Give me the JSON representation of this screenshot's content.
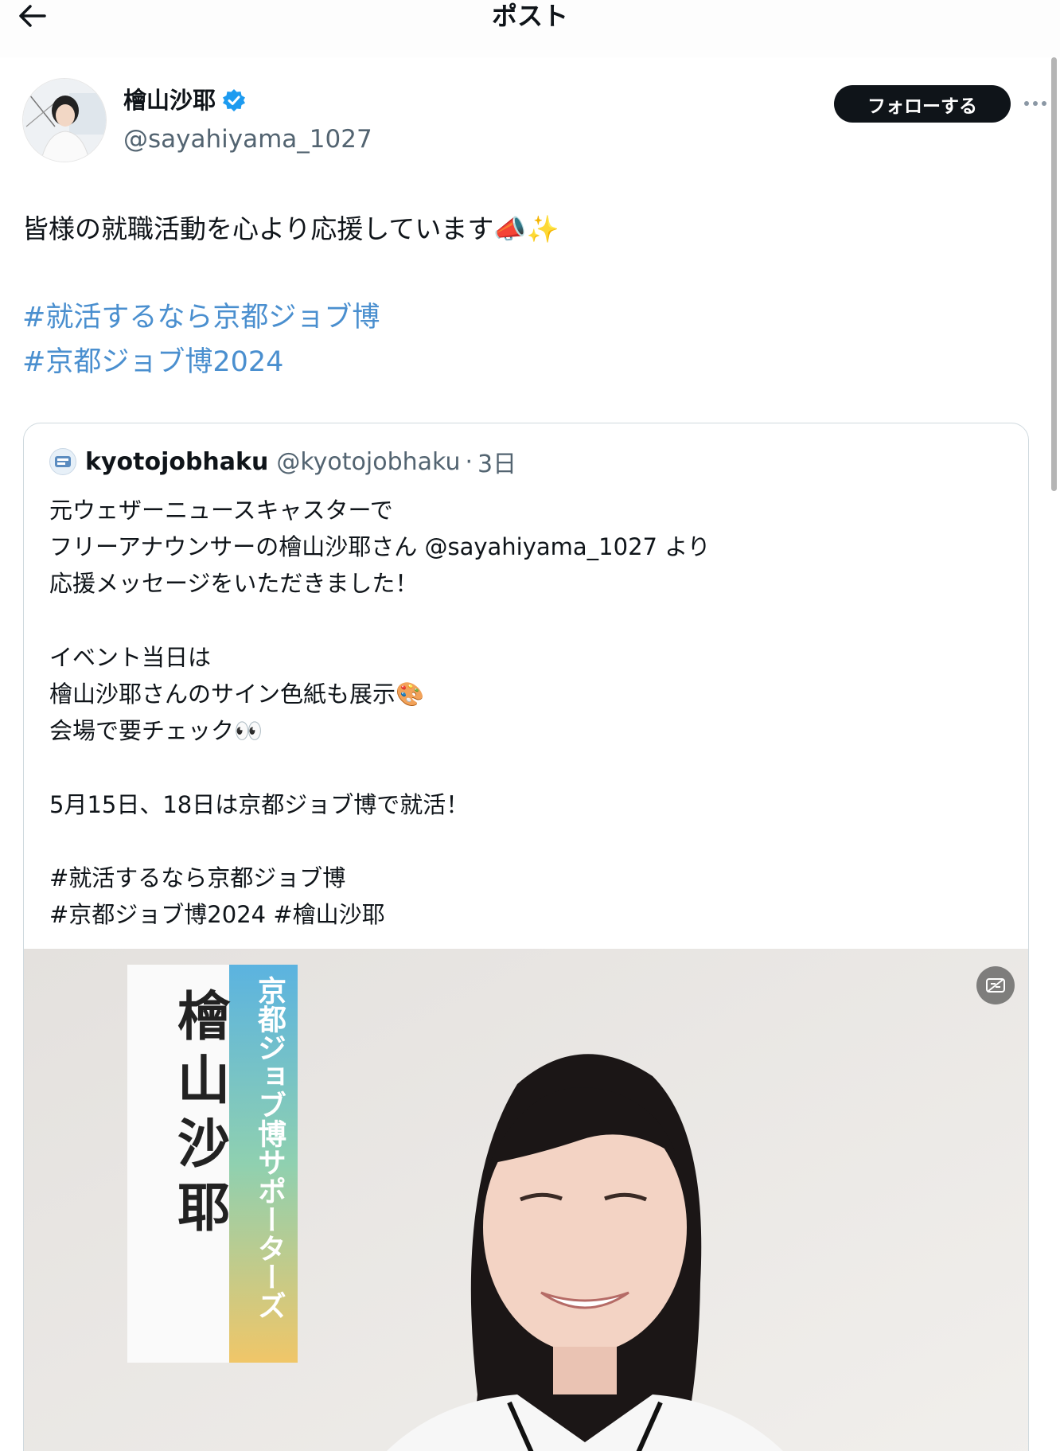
{
  "header": {
    "title": "ポスト"
  },
  "author": {
    "name": "檜山沙耶",
    "handle": "@sayahiyama_1027",
    "follow_label": "フォローする"
  },
  "post": {
    "text": "皆様の就職活動を心より応援しています📣✨",
    "hashtags": [
      "#就活するなら京都ジョブ博",
      "#京都ジョブ博2024"
    ]
  },
  "quote": {
    "name": "kyotojobhaku",
    "handle": "@kyotojobhaku",
    "separator": "·",
    "time": "3日",
    "body": "元ウェザーニュースキャスターで\nフリーアナウンサーの檜山沙耶さん @sayahiyama_1027 より\n応援メッセージをいただきました！\n\nイベント当日は\n檜山沙耶さんのサイン色紙も展示🎨\n会場で要チェック👀\n\n5月15日、18日は京都ジョブ博で就活！\n\n#就活するなら京都ジョブ博\n#京都ジョブ博2024 #檜山沙耶",
    "media": {
      "name_card": "檜山沙耶",
      "banner": "京都ジョブ博サポーターズ"
    }
  },
  "colors": {
    "accent": "#4a8fcf",
    "verified": "#1d9bf0",
    "follow_bg": "#0f1419"
  },
  "icons": [
    "back-arrow-icon",
    "verified-badge-icon",
    "more-icon",
    "media-badge-icon"
  ]
}
